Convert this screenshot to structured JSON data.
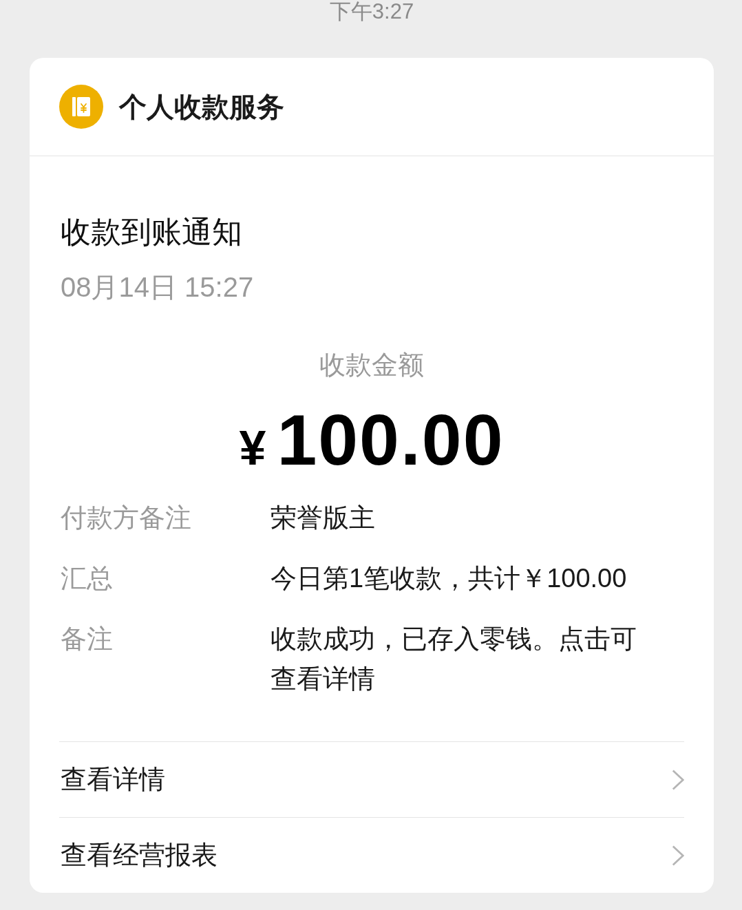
{
  "status_time": "下午3:27",
  "card": {
    "service": {
      "title": "个人收款服务"
    },
    "notice": {
      "title": "收款到账通知",
      "datetime": "08月14日 15:27",
      "amount_label": "收款金额",
      "currency": "¥",
      "amount": "100.00"
    },
    "details": [
      {
        "label": "付款方备注",
        "value": "荣誉版主"
      },
      {
        "label": "汇总",
        "value": "今日第1笔收款，共计￥100.00"
      },
      {
        "label": "备注",
        "value": "收款成功，已存入零钱。点击可查看详情"
      }
    ],
    "links": [
      {
        "label": "查看详情"
      },
      {
        "label": "查看经营报表"
      }
    ]
  }
}
